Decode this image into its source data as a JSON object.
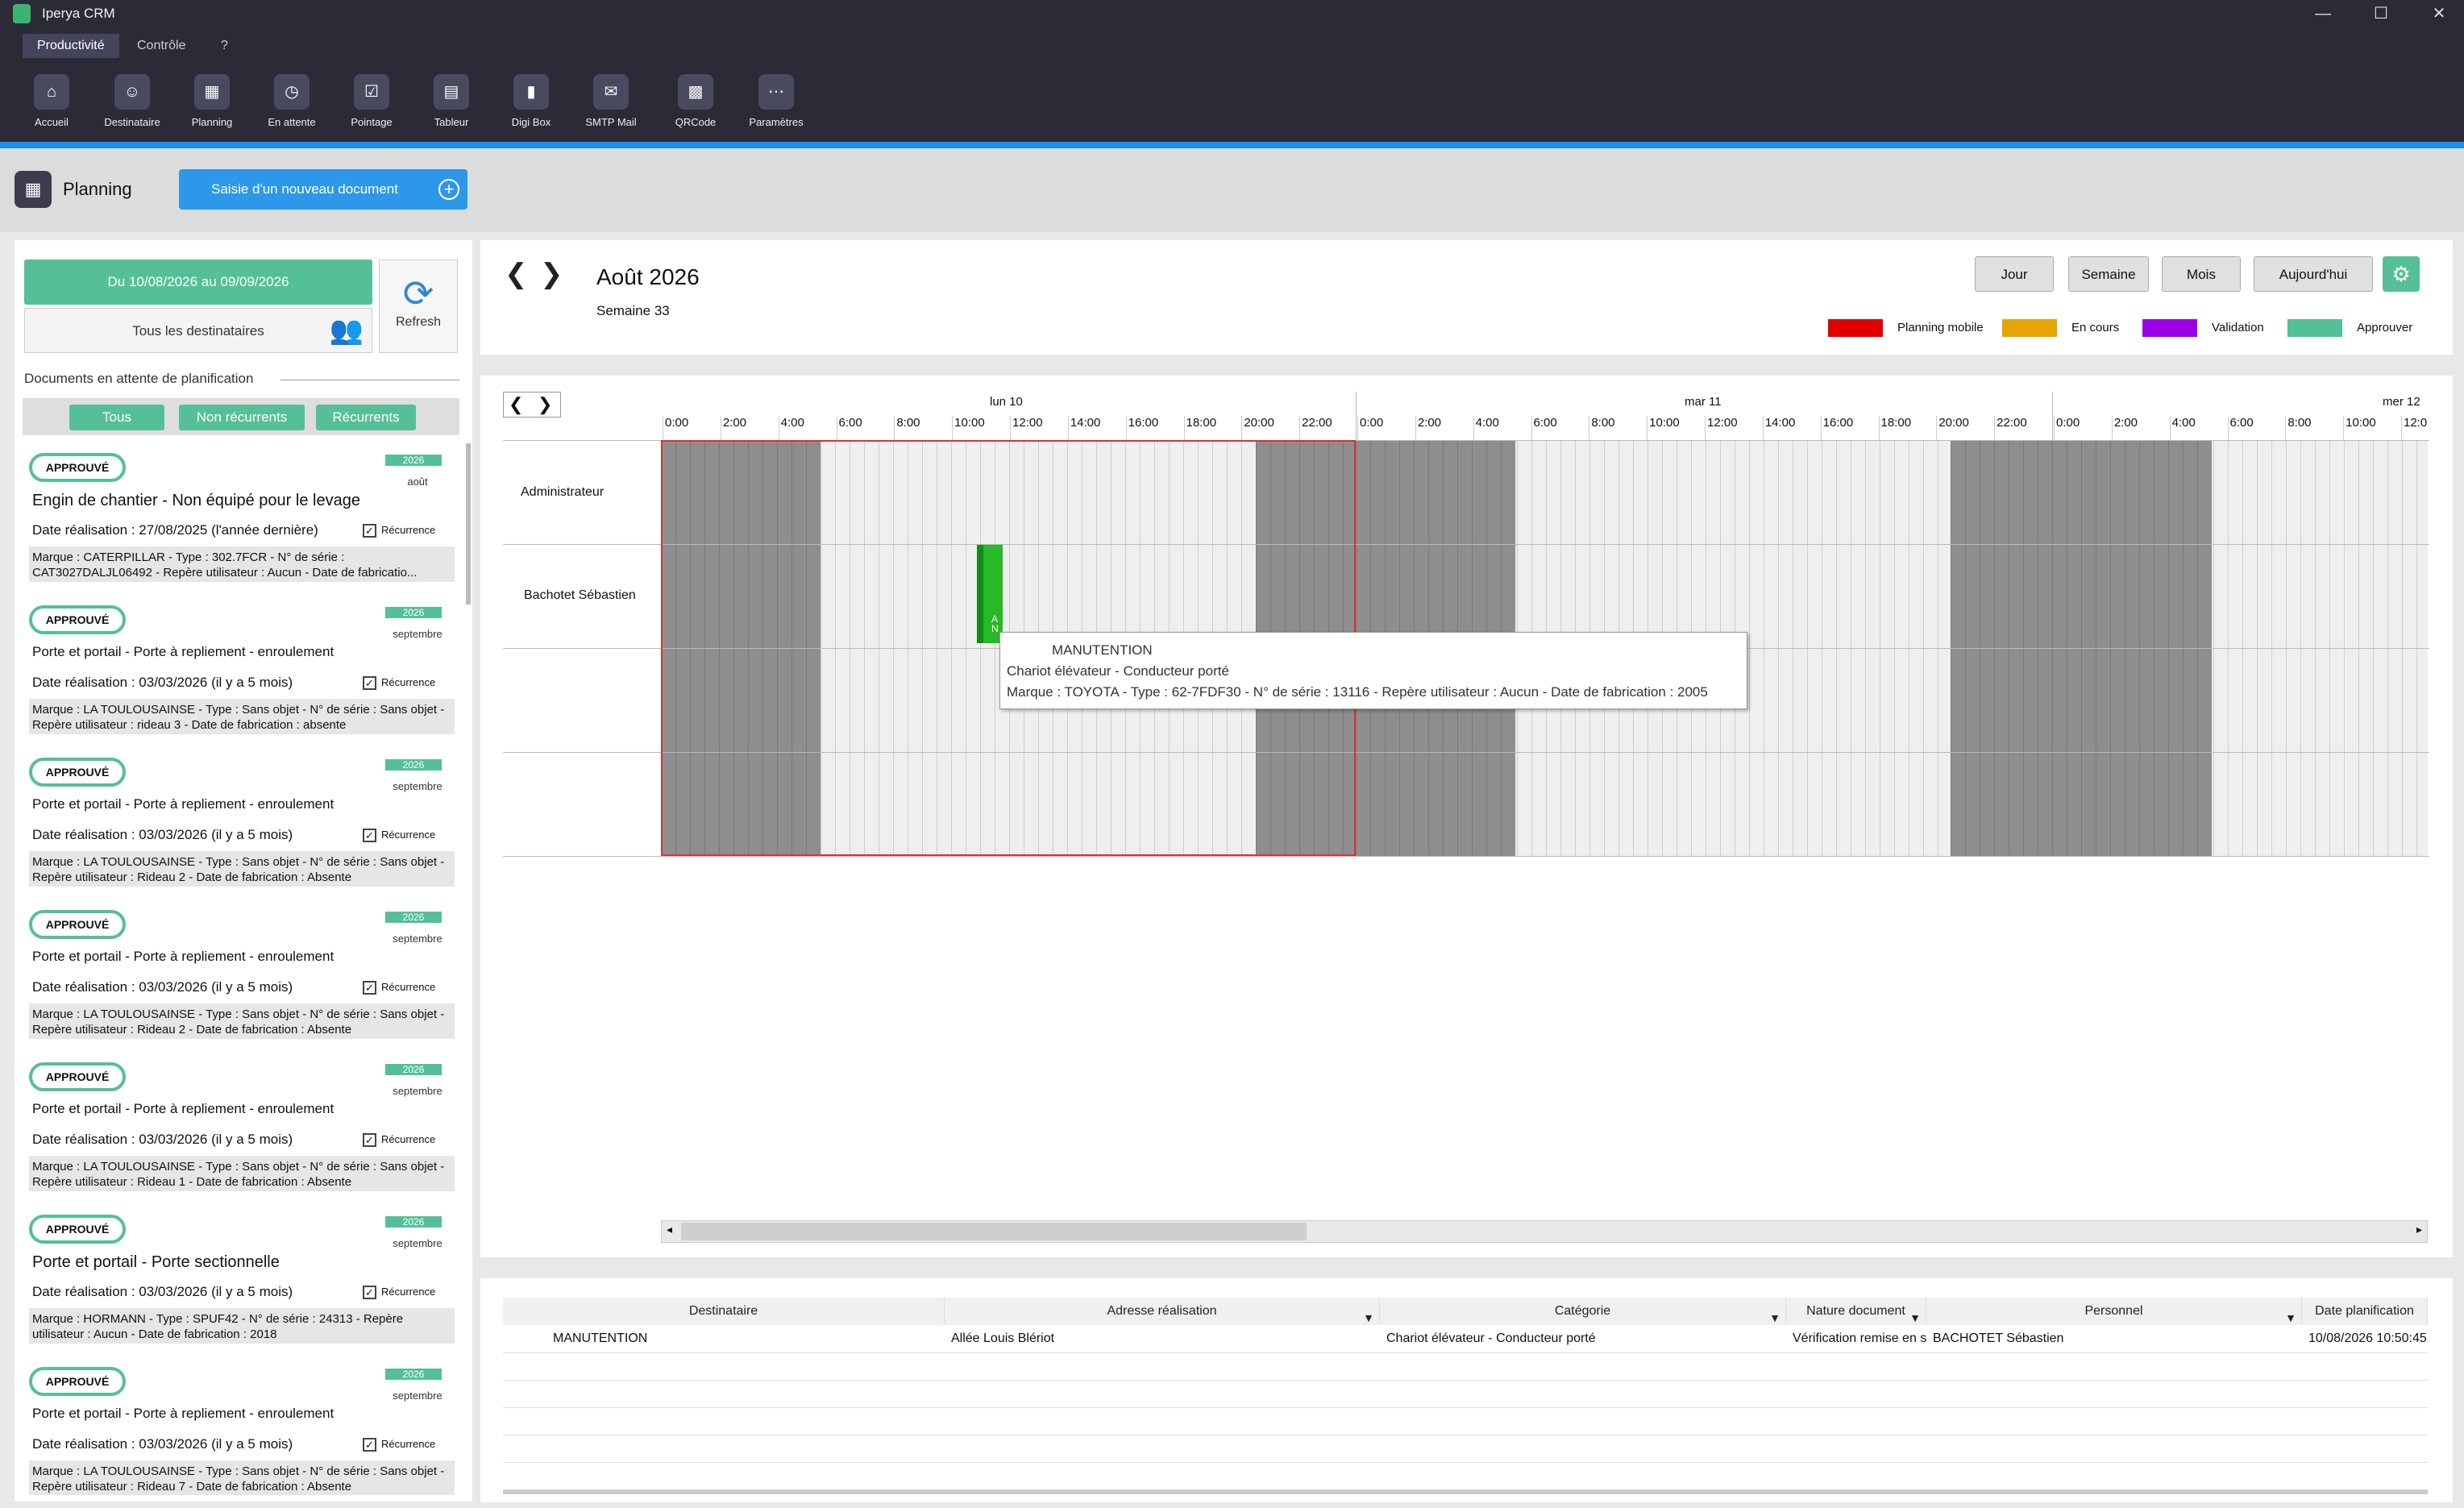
{
  "app": {
    "title": "Iperya CRM",
    "min": "—",
    "max": "☐",
    "close": "✕"
  },
  "menu": [
    "Productivité",
    "Contrôle",
    "?"
  ],
  "ribbon": [
    {
      "label": "Accueil",
      "icon": "⌂"
    },
    {
      "label": "Destinataire",
      "icon": "☺"
    },
    {
      "label": "Planning",
      "icon": "▦"
    },
    {
      "label": "En attente",
      "icon": "◷"
    },
    {
      "label": "Pointage",
      "icon": "☑"
    },
    {
      "label": "Tableur",
      "icon": "▤"
    },
    {
      "label": "Digi Box",
      "icon": "▮"
    },
    {
      "label": "SMTP Mail",
      "icon": "✉"
    },
    {
      "label": "QRCode",
      "icon": "▩"
    },
    {
      "label": "Paramètres",
      "icon": "⋯"
    }
  ],
  "page": {
    "title": "Planning",
    "new_doc": "Saisie d'un nouveau document",
    "new_doc_icon": "+"
  },
  "left": {
    "date_range": "Du 10/08/2026 au 09/09/2026",
    "destinataires": "Tous les destinataires",
    "refresh": "Refresh",
    "pending_title": "Documents en attente de planification",
    "filters": [
      "Tous",
      "Non récurrents",
      "Récurrents"
    ],
    "cards": [
      {
        "status": "APPROUVÉ",
        "year": "2026",
        "month": "août",
        "title": "Engin de chantier - Non équipé pour le levage",
        "date": "Date réalisation : 27/08/2025 (l'année dernière)",
        "recur": "Récurrence",
        "desc": "Marque : CATERPILLAR - Type : 302.7FCR - N° de série : CAT3027DALJL06492 - Repère utilisateur : Aucun  - Date de fabricatio..."
      },
      {
        "status": "APPROUVÉ",
        "year": "2026",
        "month": "septembre",
        "title": "Porte et portail - Porte à repliement - enroulement",
        "date": "Date réalisation : 03/03/2026 (il y a 5 mois)",
        "recur": "Récurrence",
        "desc": "Marque : LA TOULOUSAINSE - Type : Sans objet - N° de série : Sans objet - Repère utilisateur : rideau 3 - Date de fabrication : absente"
      },
      {
        "status": "APPROUVÉ",
        "year": "2026",
        "month": "septembre",
        "title": "Porte et portail - Porte à repliement - enroulement",
        "date": "Date réalisation : 03/03/2026 (il y a 5 mois)",
        "recur": "Récurrence",
        "desc": "Marque : LA TOULOUSAINSE - Type : Sans objet - N° de série : Sans objet - Repère utilisateur : Rideau 2 - Date de fabrication : Absente"
      },
      {
        "status": "APPROUVÉ",
        "year": "2026",
        "month": "septembre",
        "title": "Porte et portail - Porte à repliement - enroulement",
        "date": "Date réalisation : 03/03/2026 (il y a 5 mois)",
        "recur": "Récurrence",
        "desc": "Marque : LA TOULOUSAINSE - Type : Sans objet - N° de série : Sans objet - Repère utilisateur : Rideau 2 - Date de fabrication : Absente"
      },
      {
        "status": "APPROUVÉ",
        "year": "2026",
        "month": "septembre",
        "title": "Porte et portail - Porte à repliement - enroulement",
        "date": "Date réalisation : 03/03/2026 (il y a 5 mois)",
        "recur": "Récurrence",
        "desc": "Marque : LA TOULOUSAINSE - Type : Sans objet - N° de série : Sans objet - Repère utilisateur : Rideau 1 - Date de fabrication : Absente"
      },
      {
        "status": "APPROUVÉ",
        "year": "2026",
        "month": "septembre",
        "title": "Porte et portail - Porte sectionnelle",
        "date": "Date réalisation : 03/03/2026 (il y a 5 mois)",
        "recur": "Récurrence",
        "desc": "Marque : HORMANN - Type : SPUF42 - N° de série : 24313 - Repère utilisateur : Aucun - Date de fabrication : 2018"
      },
      {
        "status": "APPROUVÉ",
        "year": "2026",
        "month": "septembre",
        "title": "Porte et portail - Porte à repliement - enroulement",
        "date": "Date réalisation : 03/03/2026 (il y a 5 mois)",
        "recur": "Récurrence",
        "desc": "Marque : LA TOULOUSAINSE - Type : Sans objet - N° de série : Sans objet - Repère utilisateur : Rideau 7 - Date de fabrication : Absente"
      }
    ]
  },
  "calendar": {
    "month": "Août 2026",
    "week": "Semaine 33",
    "prev": "❮",
    "next": "❯",
    "views": [
      "Jour",
      "Semaine",
      "Mois",
      "Aujourd'hui"
    ],
    "settings": "⚙",
    "legend": [
      {
        "label": "Planning mobile",
        "color": "#e00000"
      },
      {
        "label": "En cours",
        "color": "#e5a400"
      },
      {
        "label": "Validation",
        "color": "#9b00e8"
      },
      {
        "label": "Approuver",
        "color": "#55c098"
      }
    ],
    "days": [
      "lun 10",
      "mar 11",
      "mer 12"
    ],
    "hours": [
      "0:00",
      "2:00",
      "4:00",
      "6:00",
      "8:00",
      "10:00",
      "12:00",
      "14:00",
      "16:00",
      "18:00",
      "20:00",
      "22:00"
    ],
    "hours_last": [
      "0:00",
      "2:00",
      "4:00",
      "6:00",
      "8:00",
      "10:00",
      "12:0"
    ],
    "resources": [
      "Administrateur",
      "Bachotet Sébastien",
      "",
      ""
    ],
    "event": {
      "label": "A N"
    },
    "tooltip": {
      "title": "MANUTENTION",
      "line1": "Chariot élévateur - Conducteur porté",
      "line2": "Marque : TOYOTA  - Type : 62-7FDF30 - N° de série : 13116 - Repère utilisateur : Aucun - Date de fabrication : 2005"
    },
    "scroll_left": "◂",
    "scroll_right": "▸"
  },
  "table": {
    "headers": [
      "Destinataire",
      "Adresse réalisation",
      "Catégorie",
      "Nature document",
      "Personnel",
      "Date planification"
    ],
    "row": [
      "MANUTENTION",
      "Allée Louis Blériot",
      "Chariot élévateur - Conducteur porté",
      "Vérification remise en s",
      "BACHOTET Sébastien",
      "10/08/2026 10:50:45"
    ]
  }
}
